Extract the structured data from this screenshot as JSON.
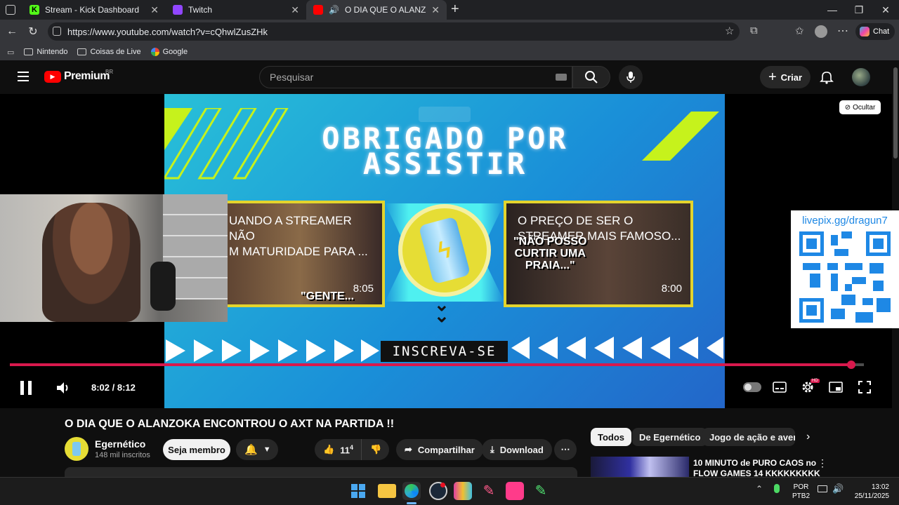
{
  "browser": {
    "tabs": [
      {
        "title": "Stream - Kick Dashboard",
        "favicon_color": "#53fc18"
      },
      {
        "title": "Twitch",
        "favicon_color": "#9146ff"
      },
      {
        "title": "O DIA QUE O ALANZOKA EN",
        "favicon_color": "#ff0000"
      }
    ],
    "url": "https://www.youtube.com/watch?v=cQhwlZusZHk",
    "chat_label": "Chat",
    "bookmarks": [
      "Nintendo",
      "Coisas de Live",
      "Google"
    ]
  },
  "youtube": {
    "logo_text": "Premium",
    "region": "BR",
    "search_placeholder": "Pesquisar",
    "create_label": "Criar"
  },
  "video": {
    "end_title_line1": "OBRIGADO POR",
    "end_title_line2": "ASSISTIR",
    "hide_label": "Ocultar",
    "card_left": {
      "title": "UANDO A STREAMER NÃO\nM MATURIDADE PARA ...",
      "caption": "\"GENTE...",
      "duration": "8:05"
    },
    "card_right": {
      "title": "O PREÇO DE SER O\nSTREAMER MAIS FAMOSO...",
      "caption": "\"NÃO POSSO\nCURTIR UMA\nPRAIA...\"",
      "duration": "8:00"
    },
    "subscribe_label": "INSCREVA-SE",
    "livepix": "livepix.gg/dragun7",
    "time": "8:02 / 8:12",
    "progress": 0.985,
    "hd_badge": "HD"
  },
  "info": {
    "title": "O DIA QUE O ALANZOKA ENCONTROU O AXT NA PARTIDA !!",
    "channel": "Egernético",
    "subscribers": "148 mil inscritos",
    "join_label": "Seja membro",
    "likes": "11",
    "likes_sup": "4",
    "share_label": "Compartilhar",
    "download_label": "Download"
  },
  "sidebar": {
    "chips": [
      "Todos",
      "De Egernético",
      "Jogo de ação e aventur"
    ],
    "rec_title_line1": "10 MINUTO de PURO CAOS no",
    "rec_title_line2": "FLOW GAMES 14 KKKKKKKKK"
  },
  "taskbar": {
    "lang1": "POR",
    "lang2": "PTB2",
    "time": "13:02",
    "date": "25/11/2025"
  },
  "colors": {
    "accent": "#d8194d",
    "card_border": "#e3d42d",
    "neon": "#c6f21c"
  }
}
